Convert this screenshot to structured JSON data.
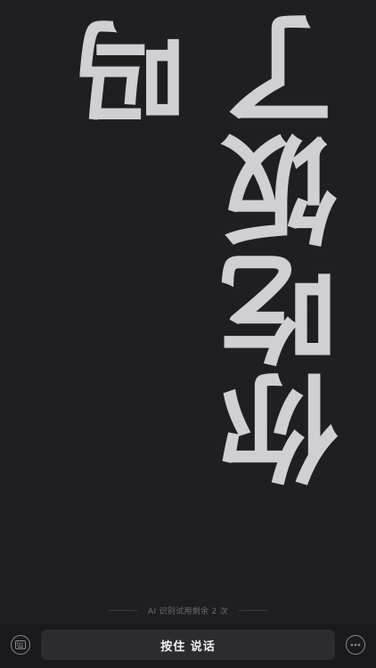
{
  "message": {
    "line1": "你吃饭了",
    "line2": "吗"
  },
  "footer": {
    "hint": "AI 识别试用剩余 2 次",
    "talk_label": "按住 说话",
    "left_icon": "keyboard-icon",
    "right_icon": "more-icon"
  },
  "colors": {
    "background": "#1f1f21",
    "text": "#cfcfd4"
  }
}
